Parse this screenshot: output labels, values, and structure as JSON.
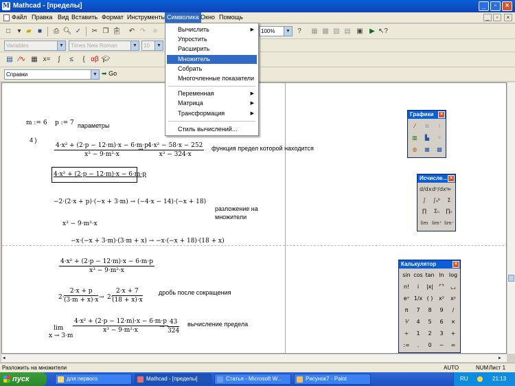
{
  "window": {
    "title": "Mathcad - [пределы]"
  },
  "menu": {
    "items": [
      "Файл",
      "Правка",
      "Вид",
      "Вставить",
      "Формат",
      "Инструменты",
      "Символика",
      "Окно",
      "Помощь"
    ]
  },
  "toolbar": {
    "zoom": "100%",
    "style_combo": "Variables",
    "font_combo": "Times New Roman",
    "size_combo": "10",
    "resources_combo": "Справки",
    "go_label": "Go"
  },
  "symbolics_menu": {
    "items": [
      {
        "label": "Вычислить",
        "submenu": true
      },
      {
        "label": "Упростить",
        "submenu": false
      },
      {
        "label": "Расширить",
        "submenu": false
      },
      {
        "label": "Множитель",
        "submenu": false,
        "selected": true
      },
      {
        "label": "Собрать",
        "submenu": false
      },
      {
        "label": "Многочленные показатели",
        "submenu": false
      },
      {
        "label": "Переменная",
        "submenu": true
      },
      {
        "label": "Матрица",
        "submenu": true
      },
      {
        "label": "Трансформация",
        "submenu": true
      },
      {
        "label": "Стиль вычислений...",
        "submenu": false
      }
    ]
  },
  "worksheet": {
    "m_def": "m := 6",
    "p_def": "p := 7",
    "params_label": "параметры",
    "item_no": "4 )",
    "expr1_num": "4·x² + (2·p − 12·m)·x − 6·m·p",
    "expr1_den": "x³ − 9·m²·x",
    "expr1_res_num": "4·x² − 58·x − 252",
    "expr1_res_den": "x³ − 324·x",
    "label_function": "функция предел которой находится",
    "selected_expr": "4·x² + (2·p − 12·m)·x − 6·m·p",
    "factor_line1": "−2·(2·x + p)·(−x + 3·m) → (−4·x − 14)·(−x + 18)",
    "label_factor": "разложение на множители",
    "den_expr": "x³ − 9·m²·x",
    "factor_line2": "−x·(−x + 3·m)·(3·m + x) → −x·(−x + 18)·(18 + x)",
    "frac2_num": "4·x² + (2·p − 12·m)·x − 6·m·p",
    "frac2_den": "x³ − 9·m²·x",
    "reduced_lhs_coef": "2·",
    "reduced_lhs_num": "2·x + p",
    "reduced_lhs_den": "(3·m + x)·x",
    "reduced_rhs_coef": "2·",
    "reduced_rhs_num": "2·x + 7",
    "reduced_rhs_den": "(18 + x)·x",
    "label_reduce": "дробь после сокращения",
    "lim_label": "lim",
    "lim_sub": "x → 3·m",
    "lim_num": "4·x² + (2·p − 12·m)·x − 6·m·p",
    "lim_den": "x³ − 9·m²·x",
    "lim_res_num": "43",
    "lim_res_den": "324",
    "label_limit": "вычисление предела"
  },
  "palettes": {
    "graphs": {
      "title": "Графики",
      "icons": [
        "xy-plot-icon",
        "polar-plot-icon",
        "surface-plot-icon",
        "contour-plot-icon",
        "3d-bar-icon",
        "scatter-plot-icon",
        "vector-field-icon",
        "3d-patch-icon",
        "animate-icon"
      ]
    },
    "calculus": {
      "title": "Исчисле...",
      "icons": [
        "d/dx",
        "dⁿ/dxⁿ",
        "∞",
        "∫",
        "∫ₐᵇ",
        "Σ",
        "∏",
        "Σₙ",
        "∏ₙ",
        "lim",
        "lim⁺",
        "lim⁻"
      ]
    },
    "calculator": {
      "title": "Калькулятор",
      "rows": [
        [
          "sin",
          "cos",
          "tan",
          "ln",
          "log"
        ],
        [
          "n!",
          "i",
          "|x|",
          "⌜⌝",
          "⌞⌟"
        ],
        [
          "eˣ",
          "1/x",
          "( )",
          "x²",
          "xʸ"
        ],
        [
          "π",
          "7",
          "8",
          "9",
          "/"
        ],
        [
          "⅟",
          "4",
          "5",
          "6",
          "×"
        ],
        [
          "÷",
          "1",
          "2",
          "3",
          "+"
        ],
        [
          ":=",
          ".",
          "0",
          "−",
          "="
        ]
      ]
    }
  },
  "status": {
    "message": "Разложить на множители",
    "mode": "AUTO",
    "num": "NUM",
    "page": "Лист 1"
  },
  "taskbar": {
    "start": "пуск",
    "tasks": [
      "для первого",
      "Mathcad - [пределы]",
      "Статья - Microsoft W...",
      "Рисунок7 - Paint"
    ],
    "lang": "RU",
    "clock": "21:13"
  }
}
